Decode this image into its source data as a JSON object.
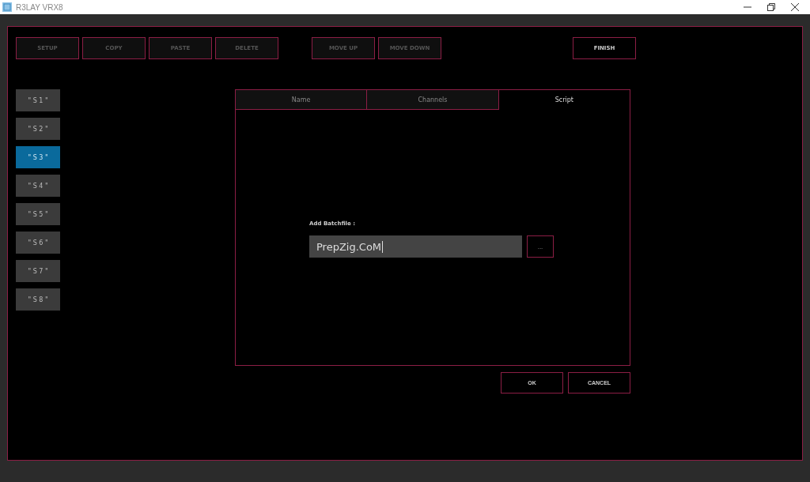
{
  "window": {
    "title": "R3LAY VRX8"
  },
  "toolbar": {
    "edit_buttons": [
      "SETUP",
      "COPY",
      "PASTE",
      "DELETE"
    ],
    "move_buttons": [
      "MOVE UP",
      "MOVE DOWN"
    ],
    "finish": "FINISH"
  },
  "slots": [
    {
      "label": "\" S 1 \"",
      "selected": false
    },
    {
      "label": "\" S 2 \"",
      "selected": false
    },
    {
      "label": "\" S 3 \"",
      "selected": true
    },
    {
      "label": "\" S 4 \"",
      "selected": false
    },
    {
      "label": "\" S 5 \"",
      "selected": false
    },
    {
      "label": "\" S 6 \"",
      "selected": false
    },
    {
      "label": "\" S 7 \"",
      "selected": false
    },
    {
      "label": "\" S 8 \"",
      "selected": false
    }
  ],
  "tabs": [
    {
      "label": "Name",
      "selected": false
    },
    {
      "label": "Channels",
      "selected": false
    },
    {
      "label": "Script",
      "selected": true
    }
  ],
  "script": {
    "label": "Add Batchfile :",
    "value": "PrepZig.CoM",
    "browse": "..."
  },
  "buttons": [
    "OK",
    "CANCEL"
  ]
}
